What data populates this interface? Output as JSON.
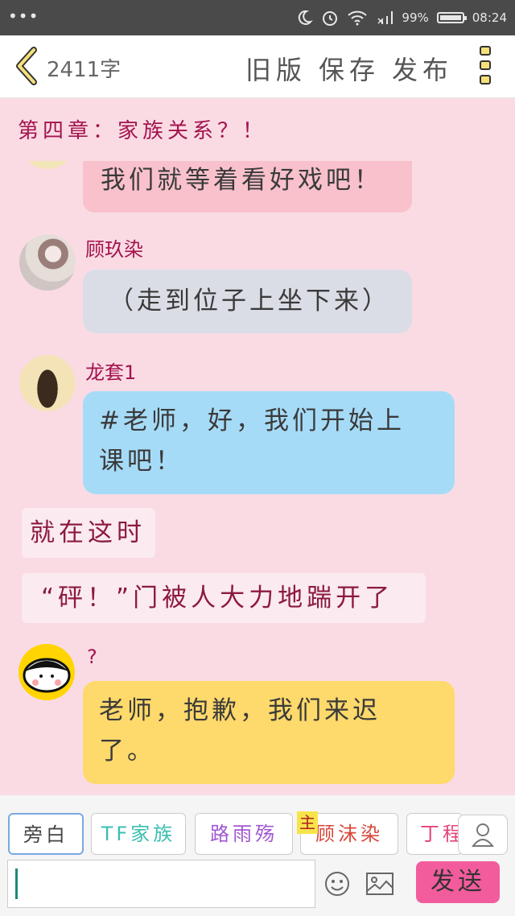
{
  "status": {
    "battery": "99%",
    "time": "08:24"
  },
  "header": {
    "word_count": "2411字",
    "old_version": "旧版",
    "save": "保存",
    "publish": "发布"
  },
  "chapter_title": "第四章：家族关系？！",
  "messages": [
    {
      "text": "我们就等着看好戏吧！",
      "bg": "#f8c1cc"
    },
    {
      "name": "顾玖染",
      "text": "（走到位子上坐下来）",
      "bg": "#dbdde6"
    },
    {
      "name": "龙套1",
      "text": "#老师，好，我们开始上课吧！",
      "bg": "#a6dbf7"
    },
    {
      "narration": "就在这时"
    },
    {
      "narration": "“砰！”门被人大力地踹开了"
    },
    {
      "name": "?",
      "text": "老师，抱歉，我们来迟了。",
      "bg": "#fed96b"
    }
  ],
  "roles": [
    {
      "label": "旁白",
      "color": "#444444"
    },
    {
      "label": "TF家族",
      "color": "#3bbfb2"
    },
    {
      "label": "路雨殇",
      "color": "#a257d1"
    },
    {
      "label": "顾沫染",
      "color": "#d8493a",
      "tag": "主"
    },
    {
      "label": "丁程",
      "color": "#e4447d"
    }
  ],
  "send_label": "发送",
  "icons": [
    "back-icon",
    "more-icon",
    "user-icon",
    "emoji-icon",
    "image-icon",
    "moon-icon",
    "alarm-icon",
    "wifi-icon",
    "signal-icon",
    "battery-icon"
  ]
}
